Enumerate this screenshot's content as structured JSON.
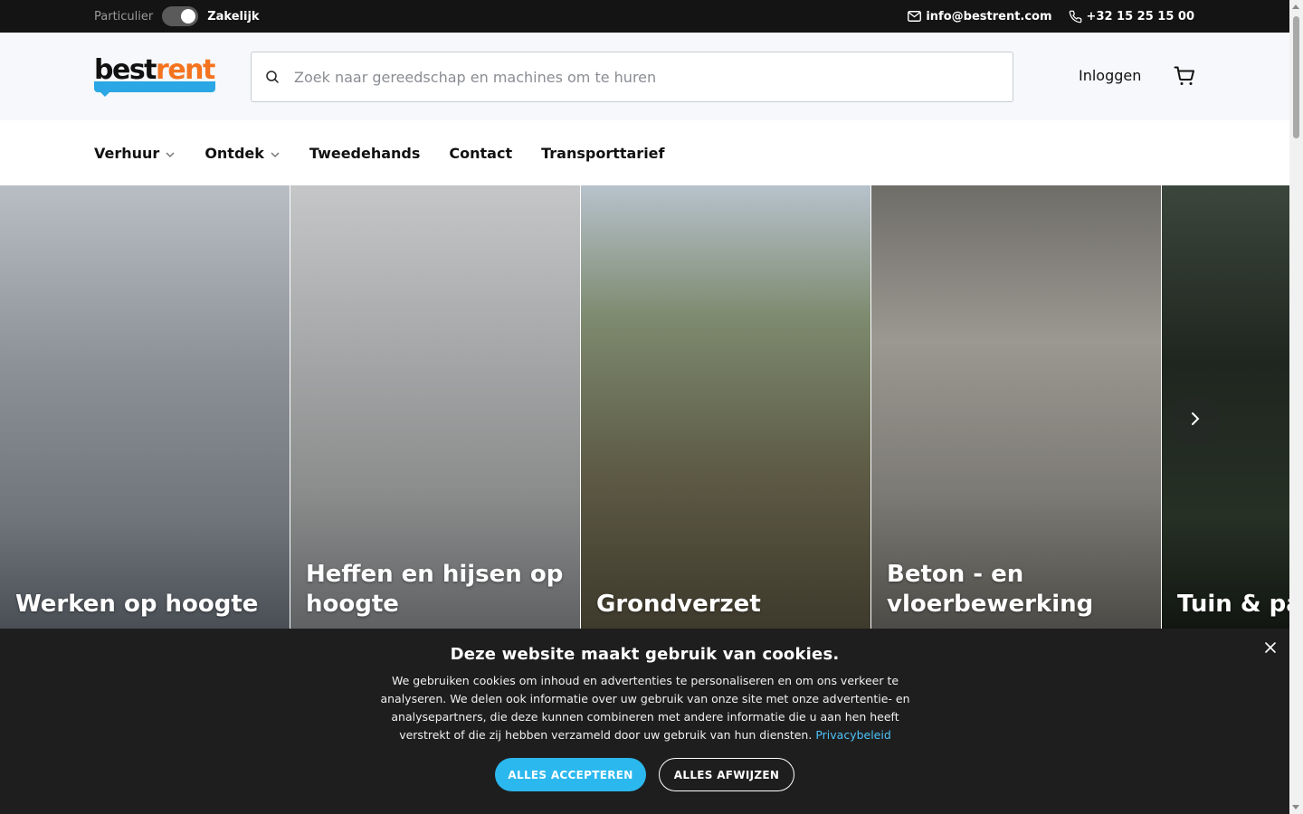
{
  "topbar": {
    "particulier": "Particulier",
    "zakelijk": "Zakelijk",
    "email": "info@bestrent.com",
    "phone": "+32 15 25 15 00"
  },
  "header": {
    "logo_best": "best",
    "logo_rent": "rent",
    "search_placeholder": "Zoek naar gereedschap en machines om te huren",
    "login": "Inloggen"
  },
  "nav": {
    "items": [
      {
        "label": "Verhuur",
        "has_dropdown": true
      },
      {
        "label": "Ontdek",
        "has_dropdown": true
      },
      {
        "label": "Tweedehands",
        "has_dropdown": false
      },
      {
        "label": "Contact",
        "has_dropdown": false
      },
      {
        "label": "Transporttarief",
        "has_dropdown": false
      }
    ]
  },
  "tiles": [
    {
      "label": "Werken op hoogte"
    },
    {
      "label": "Heffen en hijsen op hoogte"
    },
    {
      "label": "Grondverzet"
    },
    {
      "label": "Beton - en vloerbewerking"
    },
    {
      "label": "Tuin & par"
    }
  ],
  "cookie": {
    "title": "Deze website maakt gebruik van cookies.",
    "body": "We gebruiken cookies om inhoud en advertenties te personaliseren en om ons verkeer te analyseren. We delen ook informatie over uw gebruik van onze site met onze advertentie- en analysepartners, die deze kunnen combineren met andere informatie die u aan hen heeft verstrekt of die zij hebben verzameld door uw gebruik van hun diensten.",
    "privacy_link": "Privacybeleid",
    "accept": "ALLES ACCEPTEREN",
    "reject": "ALLES AFWIJZEN"
  },
  "colors": {
    "brand_orange": "#f4731f",
    "brand_blue": "#2aa7e4",
    "accept_button": "#2bb8ee",
    "topbar_bg": "#141414",
    "cookie_bg": "#1e1e1e"
  }
}
